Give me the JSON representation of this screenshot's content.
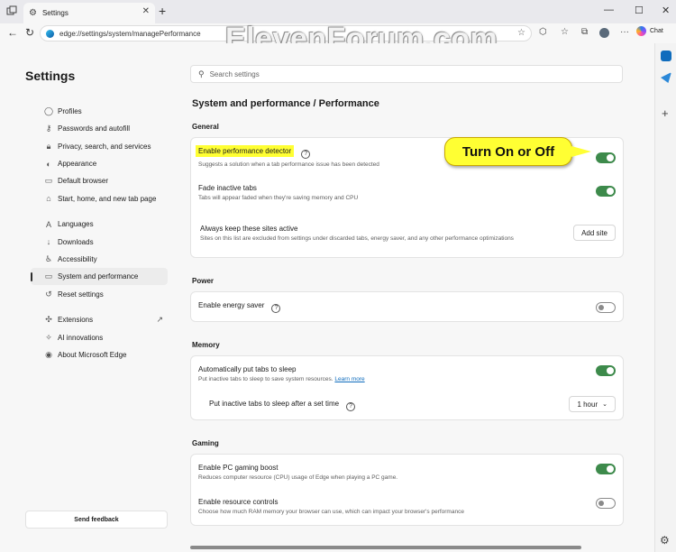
{
  "browser": {
    "tab_title": "Settings",
    "tab_icon": "gear-icon",
    "url": "edge://settings/system/managePerformance",
    "chat_label": "Chat",
    "watermark": "ElevenForum.com"
  },
  "settings_title": "Settings",
  "search": {
    "placeholder": "Search settings"
  },
  "nav": {
    "items": [
      {
        "label": "Profiles",
        "icon": "profile-icon"
      },
      {
        "label": "Passwords and autofill",
        "icon": "key-icon"
      },
      {
        "label": "Privacy, search, and services",
        "icon": "lock-icon"
      },
      {
        "label": "Appearance",
        "icon": "palette-icon"
      },
      {
        "label": "Default browser",
        "icon": "browser-icon"
      },
      {
        "label": "Start, home, and new tab page",
        "icon": "home-icon"
      },
      {
        "label": "Languages",
        "icon": "languages-icon"
      },
      {
        "label": "Downloads",
        "icon": "download-icon"
      },
      {
        "label": "Accessibility",
        "icon": "accessibility-icon"
      },
      {
        "label": "System and performance",
        "icon": "computer-icon"
      },
      {
        "label": "Reset settings",
        "icon": "reset-icon"
      },
      {
        "label": "Extensions",
        "icon": "puzzle-icon"
      },
      {
        "label": "AI innovations",
        "icon": "ai-icon"
      },
      {
        "label": "About Microsoft Edge",
        "icon": "edge-logo-icon"
      }
    ],
    "active": "System and performance"
  },
  "feedback_label": "Send feedback",
  "breadcrumb": "System and performance  /  Performance",
  "sections": {
    "general": {
      "heading": "General",
      "perf_detector": {
        "label": "Enable performance detector",
        "desc": "Suggests a solution when a tab performance issue has been detected",
        "on": true
      },
      "fade_tabs": {
        "label": "Fade inactive tabs",
        "desc": "Tabs will appear faded when they're saving memory and CPU",
        "on": true
      },
      "keep_sites": {
        "label": "Always keep these sites active",
        "desc": "Sites on this list are excluded from settings under discarded tabs, energy saver, and any other performance optimizations",
        "button": "Add site"
      }
    },
    "power": {
      "heading": "Power",
      "energy_saver": {
        "label": "Enable energy saver",
        "on": false
      }
    },
    "memory": {
      "heading": "Memory",
      "sleep_tabs": {
        "label": "Automatically put tabs to sleep",
        "desc": "Put inactive tabs to sleep to save system resources.",
        "link": "Learn more",
        "on": true
      },
      "sleep_after": {
        "label": "Put inactive tabs to sleep after a set time",
        "value": "1 hour"
      }
    },
    "gaming": {
      "heading": "Gaming",
      "boost": {
        "label": "Enable PC gaming boost",
        "desc": "Reduces computer resource (CPU) usage of Edge when playing a PC game.",
        "on": true
      },
      "resource": {
        "label": "Enable resource controls",
        "desc": "Choose how much RAM memory your browser can use, which can impact your browser's performance",
        "on": false
      }
    }
  },
  "callout": "Turn On or Off",
  "colors": {
    "toggle_on": "#3d8a4b",
    "highlight": "#ffff33",
    "link": "#0f6cbd"
  }
}
